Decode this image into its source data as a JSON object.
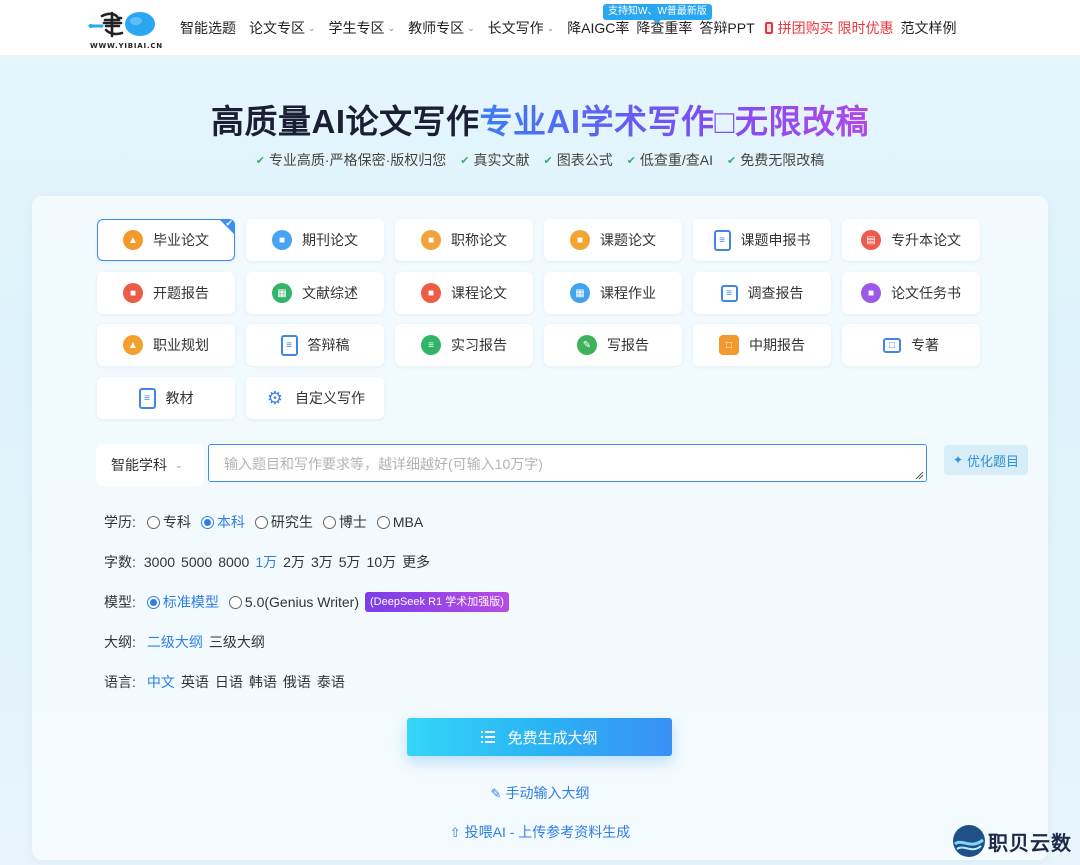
{
  "brand": {
    "logo_text": "笔Ai",
    "logo_url_text": "WWW.YIBIAI.CN"
  },
  "nav": {
    "items": [
      {
        "label": "智能选题",
        "has_dropdown": false
      },
      {
        "label": "论文专区",
        "has_dropdown": true
      },
      {
        "label": "学生专区",
        "has_dropdown": true
      },
      {
        "label": "教师专区",
        "has_dropdown": true
      },
      {
        "label": "长文写作",
        "has_dropdown": true
      },
      {
        "label": "降AIGC率",
        "has_dropdown": false
      },
      {
        "label": "降查重率",
        "has_dropdown": false
      },
      {
        "label": "答辩PPT",
        "has_dropdown": false
      },
      {
        "label": "拼团购买 限时优惠",
        "has_dropdown": false,
        "highlight": true
      },
      {
        "label": "范文样例",
        "has_dropdown": false
      }
    ],
    "badge": "支持知W、W普最新版"
  },
  "hero": {
    "title_dark": "高质量AI论文写作",
    "title_gradient": "专业AI学术写作□无限改稿",
    "features": [
      "专业高质·严格保密·版权归您",
      "真实文献",
      "图表公式",
      "低查重/查AI",
      "免费无限改稿"
    ]
  },
  "paper_types": [
    {
      "label": "毕业论文",
      "icon": "graduation-cap-icon",
      "color": "#f39a2e",
      "active": true
    },
    {
      "label": "期刊论文",
      "icon": "journal-icon",
      "color": "#4aa3f0",
      "active": false
    },
    {
      "label": "职称论文",
      "icon": "title-certificate-icon",
      "color": "#f1a43a",
      "active": false
    },
    {
      "label": "课题论文",
      "icon": "topic-paper-icon",
      "color": "#f3a531",
      "active": false
    },
    {
      "label": "课题申报书",
      "icon": "document-outline-icon",
      "color": "#3f86e8",
      "active": false
    },
    {
      "label": "专升本论文",
      "icon": "printer-icon",
      "color": "#ef5a4e",
      "active": false
    },
    {
      "label": "开题报告",
      "icon": "proposal-report-icon",
      "color": "#ee5b48",
      "active": false
    },
    {
      "label": "文献综述",
      "icon": "literature-review-icon",
      "color": "#34b36a",
      "active": false
    },
    {
      "label": "课程论文",
      "icon": "course-paper-icon",
      "color": "#ef5c45",
      "active": false
    },
    {
      "label": "课程作业",
      "icon": "course-homework-icon",
      "color": "#42a4ef",
      "active": false
    },
    {
      "label": "调查报告",
      "icon": "survey-report-icon",
      "color": "#3f86e8",
      "active": false
    },
    {
      "label": "论文任务书",
      "icon": "task-book-icon",
      "color": "#9b5be8",
      "active": false
    },
    {
      "label": "职业规划",
      "icon": "career-plan-icon",
      "color": "#f3a12c",
      "active": false
    },
    {
      "label": "答辩稿",
      "icon": "checklist-icon",
      "color": "#3f86e8",
      "active": false
    },
    {
      "label": "实习报告",
      "icon": "internship-report-icon",
      "color": "#30b467",
      "active": false
    },
    {
      "label": "写报告",
      "icon": "write-report-icon",
      "color": "#3cb35a",
      "active": false
    },
    {
      "label": "中期报告",
      "icon": "midterm-report-icon",
      "color": "#f39a2e",
      "active": false
    },
    {
      "label": "专著",
      "icon": "book-icon",
      "color": "#3f86e8",
      "active": false
    },
    {
      "label": "教材",
      "icon": "textbook-icon",
      "color": "#3f86e8",
      "active": false
    },
    {
      "label": "自定义写作",
      "icon": "sliders-icon",
      "color": "#3f86e8",
      "active": false
    }
  ],
  "input": {
    "subject_label": "智能学科",
    "placeholder": "输入题目和写作要求等，越详细越好(可输入10万字)",
    "optimize_label": "优化题目"
  },
  "education": {
    "label": "学历:",
    "options": [
      "专科",
      "本科",
      "研究生",
      "博士",
      "MBA"
    ],
    "selected": "本科"
  },
  "word_count": {
    "label": "字数:",
    "options": [
      "3000",
      "5000",
      "8000",
      "1万",
      "2万",
      "3万",
      "5万",
      "10万",
      "更多"
    ],
    "selected": "1万"
  },
  "model": {
    "label": "模型:",
    "options": [
      "标准模型",
      "5.0(Genius Writer)"
    ],
    "selected": "标准模型",
    "tag": "(DeepSeek R1 学术加强版)"
  },
  "outline": {
    "label": "大纲:",
    "options": [
      "二级大纲",
      "三级大纲"
    ],
    "selected": "二级大纲"
  },
  "language": {
    "label": "语言:",
    "options": [
      "中文",
      "英语",
      "日语",
      "韩语",
      "俄语",
      "泰语"
    ],
    "selected": "中文"
  },
  "actions": {
    "generate_label": "免费生成大纲",
    "manual_outline_label": "手动输入大纲",
    "upload_label": "投喂AI - 上传参考资料生成"
  },
  "watermark": {
    "text": "职贝云数"
  }
}
